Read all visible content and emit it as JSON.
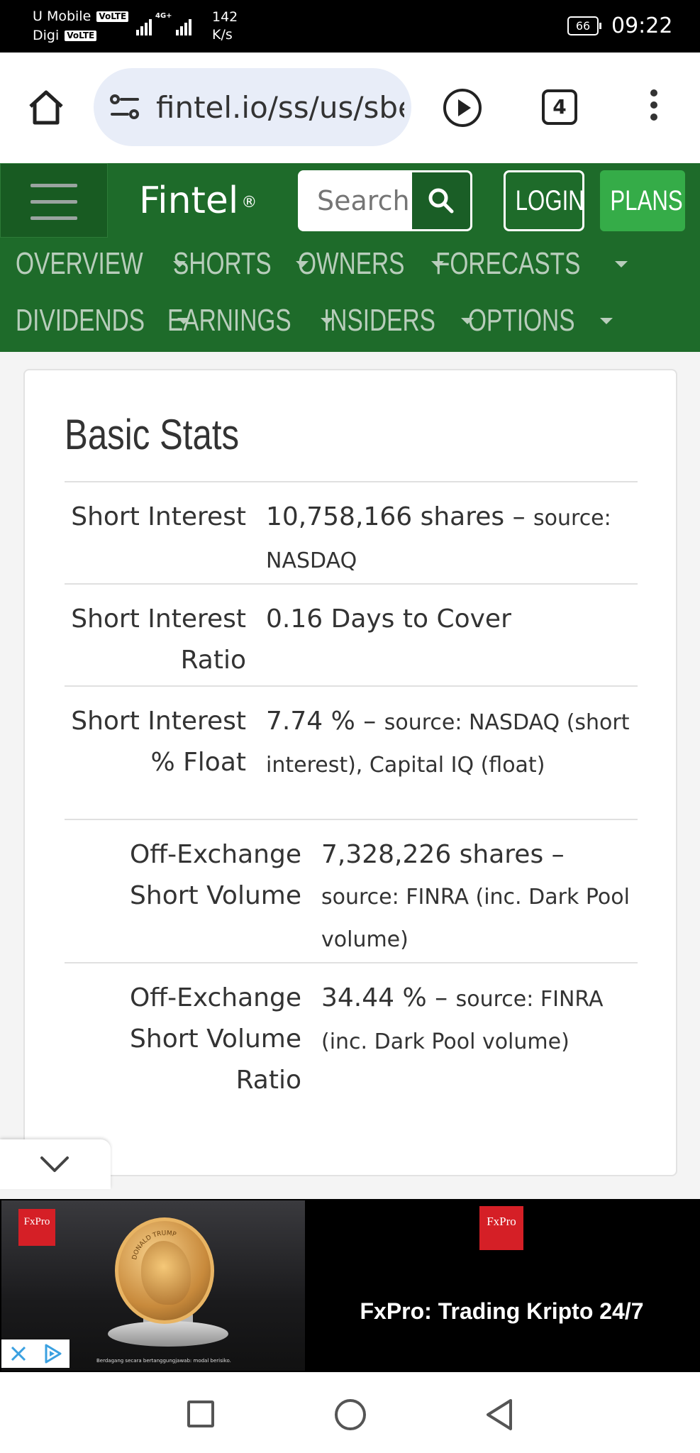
{
  "status_bar": {
    "carrier1": "U Mobile",
    "carrier2": "Digi",
    "volte": "VoLTE",
    "network": "4G+",
    "speed_value": "142",
    "speed_unit": "K/s",
    "battery": "66",
    "time": "09:22"
  },
  "browser": {
    "url": "fintel.io/ss/us/sbet",
    "tab_count": "4"
  },
  "fintel": {
    "logo": "Fintel",
    "logo_mark": "®",
    "search_placeholder": "Search",
    "login_label": "LOGIN",
    "plans_label": "PLANS",
    "nav_row1": [
      "OVERVIEW",
      "SHORTS",
      "OWNERS",
      "FORECASTS"
    ],
    "nav_row2": [
      "DIVIDENDS",
      "EARNINGS",
      "INSIDERS",
      "OPTIONS"
    ],
    "brand_color": "#1e6b2a",
    "accent_color": "#35ac48"
  },
  "basic_stats": {
    "title": "Basic Stats",
    "rows": [
      {
        "label_line1": "Short Interest",
        "label_line2": "",
        "value": "10,758,166 shares",
        "sep": " – ",
        "source": "source: NASDAQ"
      },
      {
        "label_line1": "Short Interest",
        "label_line2": "Ratio",
        "value": "0.16 Days to Cover",
        "sep": "",
        "source": ""
      },
      {
        "label_line1": "Short Interest",
        "label_line2": "% Float",
        "value": "7.74 %",
        "sep": " – ",
        "source": "source: NASDAQ (short interest), Capital IQ (float)"
      },
      {
        "label_line1": "Off-Exchange",
        "label_line2": "Short Volume",
        "value": "7,328,226 shares",
        "sep": " – ",
        "source": "source: FINRA (inc. Dark Pool volume)"
      },
      {
        "label_line1": "Off-Exchange",
        "label_line2": "Short Volume Ratio",
        "value": "34.44 %",
        "sep": " – ",
        "source": "source: FINRA (inc. Dark Pool volume)"
      }
    ]
  },
  "ad": {
    "logo_text": "FxPro",
    "coin_text": "DONALD TRUMP",
    "small_text": "Berdagang secara bertanggungjawab: modal berisiko.",
    "headline": "FxPro: Trading Kripto 24/7"
  }
}
